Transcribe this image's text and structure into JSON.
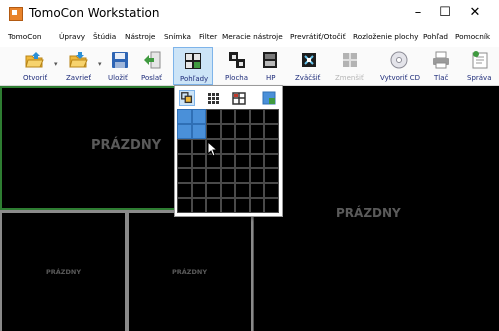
{
  "window": {
    "title": "TomoCon Workstation",
    "minimize_glyph": "–",
    "maximize_glyph": "☐",
    "close_glyph": "✕"
  },
  "menu": [
    "TomoCon",
    "Úpravy",
    "Štúdia",
    "Nástroje",
    "Snímka",
    "Filter",
    "Meracie nástroje",
    "Prevrátiť/Otočiť",
    "Rozloženie plochy",
    "Pohľad",
    "Pomocník"
  ],
  "toolbar": {
    "open": "Otvoriť",
    "close": "Zavrieť",
    "save": "Uložiť",
    "send": "Poslať",
    "views": "Pohľady",
    "desktop": "Plocha",
    "hp": "HP",
    "zoom_in": "Zväčšiť",
    "zoom_out": "Zmenšiť",
    "create_cd": "Vytvoriť CD",
    "print": "Tlač",
    "message": "Správa"
  },
  "panes": {
    "main_label": "PRÁZDNY",
    "right_label": "PRÁZDNY",
    "bottom_left_label": "PRÁZDNY",
    "bottom_mid_label": "PRÁZDNY"
  },
  "layout_popup": {
    "grid_columns": 7,
    "grid_rows": 7,
    "selected_columns": 2,
    "selected_rows": 2
  },
  "colors": {
    "selection": "#4a90d9",
    "active_border": "#2e7d32",
    "pane_label": "#5a5a5a"
  },
  "icons": [
    "folder-open-icon",
    "folder-close-icon",
    "save-disk-icon",
    "send-icon",
    "views-icon",
    "desktop-layout-icon",
    "hp-icon",
    "zoom-in-icon",
    "zoom-out-icon",
    "cd-icon",
    "printer-icon",
    "message-icon"
  ]
}
